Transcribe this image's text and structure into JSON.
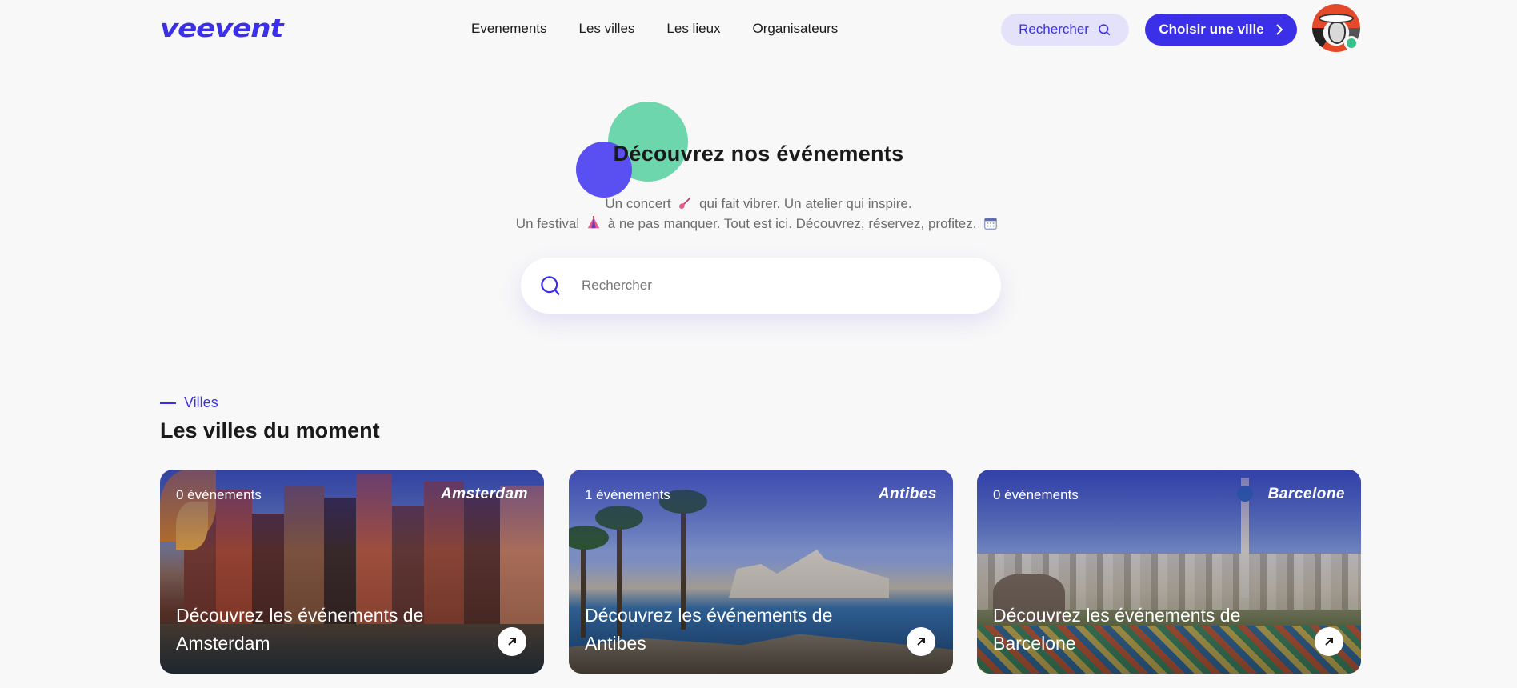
{
  "header": {
    "logo": "veevent",
    "nav": [
      "Evenements",
      "Les villes",
      "Les lieux",
      "Organisateurs"
    ],
    "search_label": "Rechercher",
    "city_label": "Choisir une ville"
  },
  "hero": {
    "title": "Découvrez nos événements",
    "line1_a": "Un concert",
    "line1_b": "qui fait vibrer. Un atelier qui inspire.",
    "line2_a": "Un festival",
    "line2_b": "à ne pas manquer. Tout est ici. Découvrez, réservez, profitez.",
    "search_placeholder": "Rechercher"
  },
  "section": {
    "eyebrow": "Villes",
    "title": "Les villes du moment"
  },
  "cities": [
    {
      "count": "0 événements",
      "name": "Amsterdam",
      "caption": "Découvrez les événements de Amsterdam"
    },
    {
      "count": "1 événements",
      "name": "Antibes",
      "caption": "Découvrez les événements de Antibes"
    },
    {
      "count": "0 événements",
      "name": "Barcelone",
      "caption": "Découvrez les événements de Barcelone"
    }
  ],
  "colors": {
    "accent": "#3b30e8",
    "green": "#6ed6ad",
    "online": "#37c08a"
  }
}
